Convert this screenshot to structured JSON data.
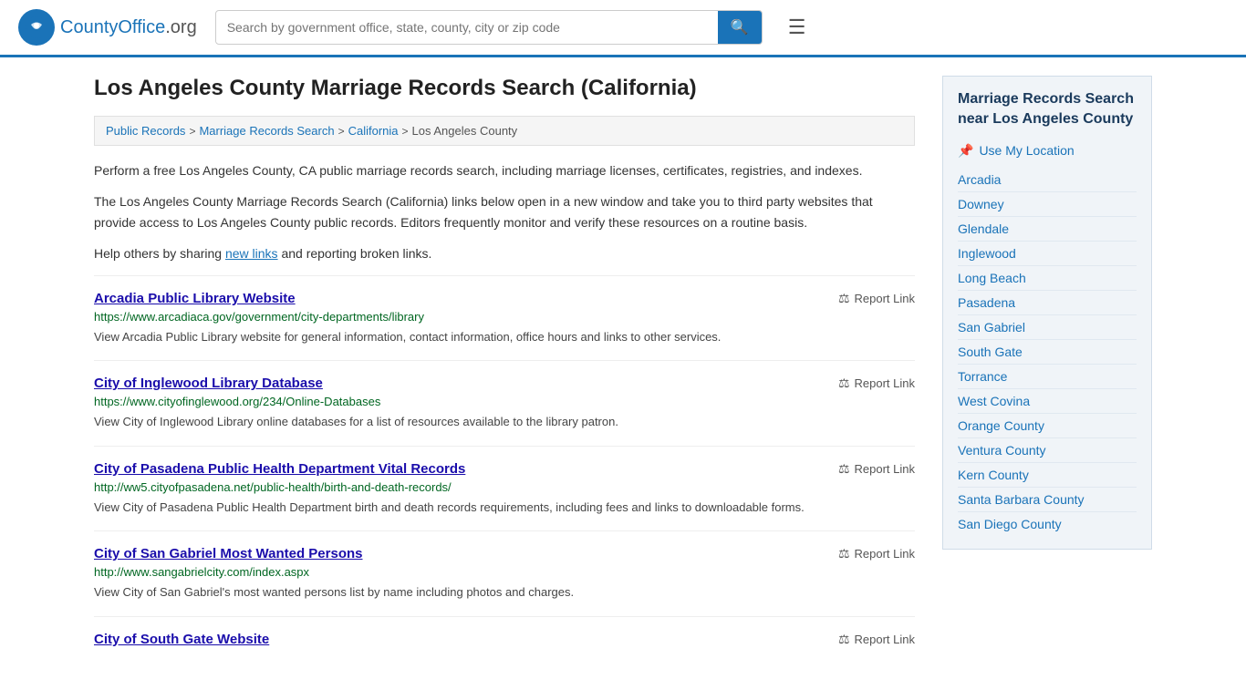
{
  "header": {
    "logo_text": "CountyOffice",
    "logo_tld": ".org",
    "search_placeholder": "Search by government office, state, county, city or zip code",
    "search_value": ""
  },
  "page_title": "Los Angeles County Marriage Records Search (California)",
  "breadcrumb": {
    "items": [
      {
        "label": "Public Records",
        "href": "#"
      },
      {
        "label": "Marriage Records Search",
        "href": "#"
      },
      {
        "label": "California",
        "href": "#"
      },
      {
        "label": "Los Angeles County",
        "href": "#",
        "current": true
      }
    ]
  },
  "description": {
    "para1": "Perform a free Los Angeles County, CA public marriage records search, including marriage licenses, certificates, registries, and indexes.",
    "para2": "The Los Angeles County Marriage Records Search (California) links below open in a new window and take you to third party websites that provide access to Los Angeles County public records. Editors frequently monitor and verify these resources on a routine basis.",
    "para3_prefix": "Help others by sharing ",
    "para3_link": "new links",
    "para3_suffix": " and reporting broken links."
  },
  "results": [
    {
      "title": "Arcadia Public Library Website",
      "url": "https://www.arcadiaca.gov/government/city-departments/library",
      "description": "View Arcadia Public Library website for general information, contact information, office hours and links to other services.",
      "report_label": "Report Link"
    },
    {
      "title": "City of Inglewood Library Database",
      "url": "https://www.cityofinglewood.org/234/Online-Databases",
      "description": "View City of Inglewood Library online databases for a list of resources available to the library patron.",
      "report_label": "Report Link"
    },
    {
      "title": "City of Pasadena Public Health Department Vital Records",
      "url": "http://ww5.cityofpasadena.net/public-health/birth-and-death-records/",
      "description": "View City of Pasadena Public Health Department birth and death records requirements, including fees and links to downloadable forms.",
      "report_label": "Report Link"
    },
    {
      "title": "City of San Gabriel Most Wanted Persons",
      "url": "http://www.sangabrielcity.com/index.aspx",
      "description": "View City of San Gabriel's most wanted persons list by name including photos and charges.",
      "report_label": "Report Link"
    },
    {
      "title": "City of South Gate Website",
      "url": "",
      "description": "",
      "report_label": "Report Link"
    }
  ],
  "sidebar": {
    "title": "Marriage Records Search near Los Angeles County",
    "use_my_location": "Use My Location",
    "links": [
      "Arcadia",
      "Downey",
      "Glendale",
      "Inglewood",
      "Long Beach",
      "Pasadena",
      "San Gabriel",
      "South Gate",
      "Torrance",
      "West Covina",
      "Orange County",
      "Ventura County",
      "Kern County",
      "Santa Barbara County",
      "San Diego County"
    ]
  }
}
